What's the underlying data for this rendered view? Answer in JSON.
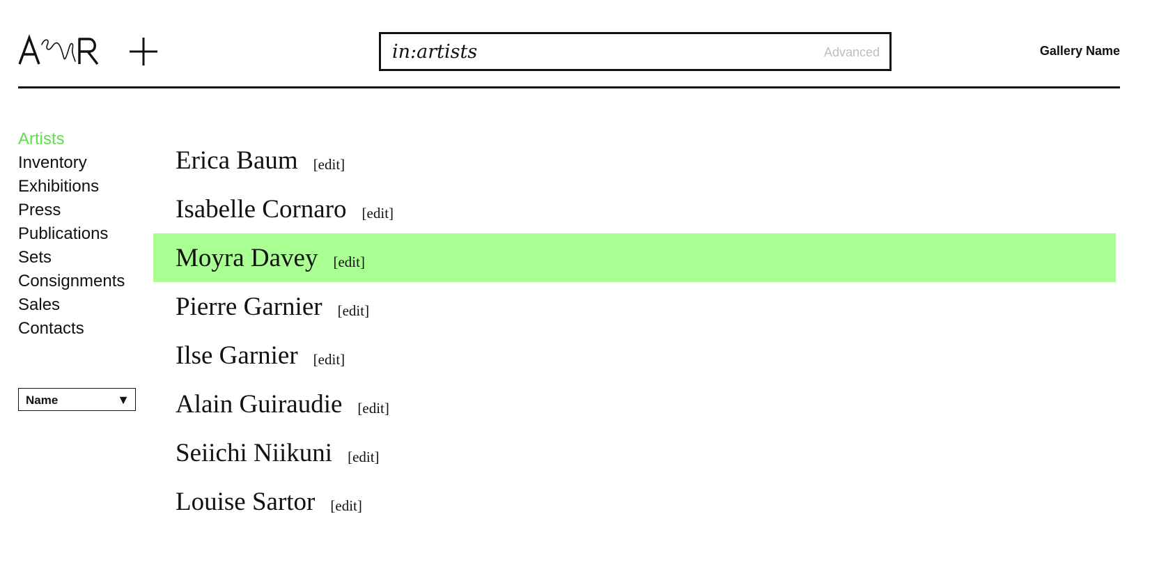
{
  "header": {
    "logo_alt": "A R",
    "add_icon": "plus-icon",
    "search": {
      "value": "in:artists",
      "advanced_label": "Advanced"
    },
    "gallery_name": "Gallery Name"
  },
  "sidebar": {
    "items": [
      {
        "label": "Artists",
        "active": true
      },
      {
        "label": "Inventory",
        "active": false
      },
      {
        "label": "Exhibitions",
        "active": false
      },
      {
        "label": "Press",
        "active": false
      },
      {
        "label": "Publications",
        "active": false
      },
      {
        "label": "Sets",
        "active": false
      },
      {
        "label": "Consignments",
        "active": false
      },
      {
        "label": "Sales",
        "active": false
      },
      {
        "label": "Contacts",
        "active": false
      }
    ],
    "sort": {
      "selected": "Name",
      "arrow_icon": "triangle-down-icon"
    }
  },
  "artists": {
    "selected_index": 2,
    "edit_label": "[edit]",
    "items": [
      {
        "name": "Erica Baum"
      },
      {
        "name": "Isabelle Cornaro"
      },
      {
        "name": "Moyra Davey"
      },
      {
        "name": "Pierre Garnier"
      },
      {
        "name": "Ilse Garnier"
      },
      {
        "name": "Alain Guiraudie"
      },
      {
        "name": "Seiichi Niikuni"
      },
      {
        "name": "Louise Sartor"
      }
    ]
  },
  "colors": {
    "accent": "#5ee04a",
    "selected_row": "#aaff93",
    "muted_text": "#bdbdbd",
    "text": "#111111"
  }
}
